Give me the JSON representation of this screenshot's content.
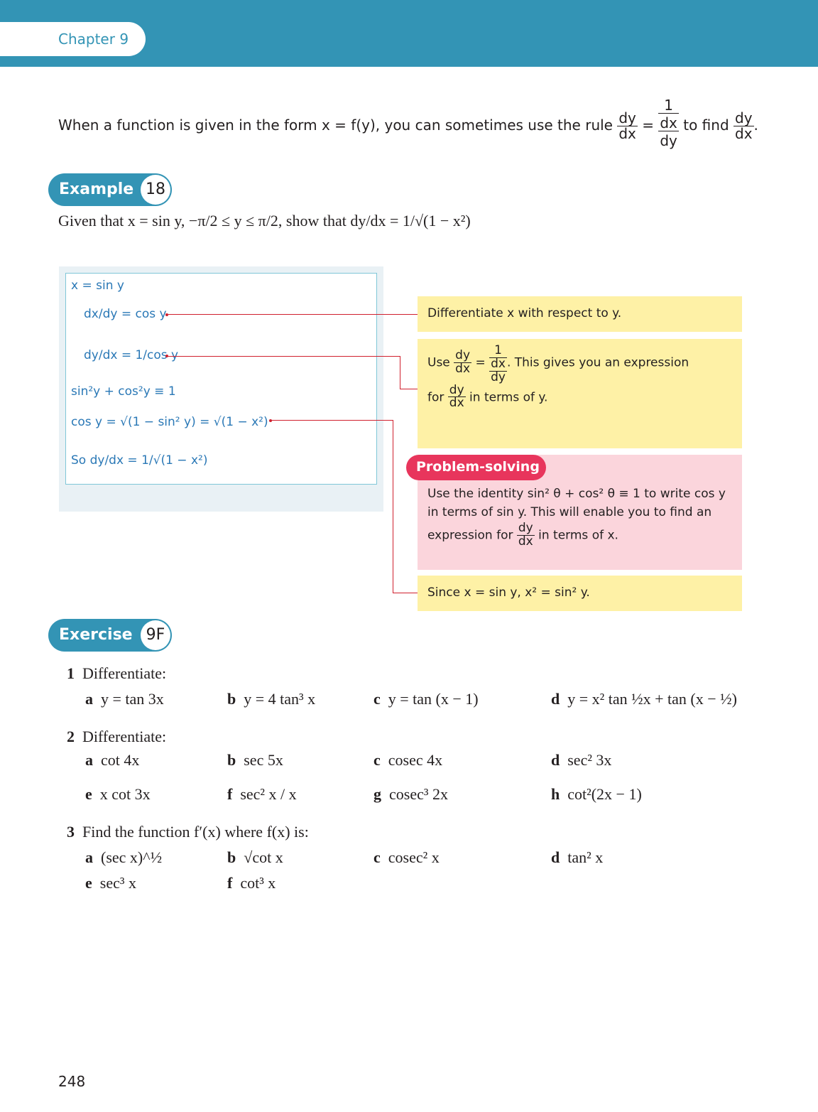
{
  "header": {
    "chapter_label": "Chapter 9"
  },
  "intro": {
    "text": "When a function is given in the form x = f(y), you can sometimes use the rule",
    "rule_lhs_num": "dy",
    "rule_lhs_den": "dx",
    "rule_eq": "=",
    "rule_rhs_num": "1",
    "rule_rhs_den_num": "dx",
    "rule_rhs_den_den": "dy",
    "to_find": "to find",
    "find_num": "dy",
    "find_den": "dx",
    "end": "."
  },
  "example": {
    "label": "Example",
    "number": "18",
    "given_text": "Given that x = sin y, −π/2 ≤ y ≤ π/2, show that dy/dx = 1/√(1 − x²)"
  },
  "working": [
    "x = sin y",
    "dx/dy = cos y",
    "dy/dx = 1/cos y",
    "sin²y + cos²y ≡ 1",
    "cos y = √(1 − sin² y) = √(1 − x²)",
    "So dy/dx = 1/√(1 − x²)"
  ],
  "notes": {
    "n1": "Differentiate x with respect to y.",
    "n2_use": "Use",
    "n2_gives": ". This gives you an expression",
    "n2_for": "for",
    "n2_tail": "in terms of y.",
    "problem_solving_tag": "Problem-solving",
    "ps_line1": "Use the identity sin² θ + cos² θ ≡ 1 to write cos y",
    "ps_line2": "in terms of sin y. This will enable you to find an",
    "ps_line3a": "expression for",
    "ps_line3b": "in terms of x.",
    "n4": "Since x = sin y, x² = sin² y."
  },
  "exercise": {
    "label": "Exercise",
    "code": "9F",
    "questions": [
      {
        "num": "1",
        "prompt": "Differentiate:",
        "parts": [
          {
            "letter": "a",
            "text": "y = tan 3x"
          },
          {
            "letter": "b",
            "text": "y = 4 tan³ x"
          },
          {
            "letter": "c",
            "text": "y = tan (x − 1)"
          },
          {
            "letter": "d",
            "text": "y = x² tan ½x + tan (x − ½)"
          }
        ]
      },
      {
        "num": "2",
        "prompt": "Differentiate:",
        "parts": [
          {
            "letter": "a",
            "text": "cot 4x"
          },
          {
            "letter": "b",
            "text": "sec 5x"
          },
          {
            "letter": "c",
            "text": "cosec 4x"
          },
          {
            "letter": "d",
            "text": "sec² 3x"
          },
          {
            "letter": "e",
            "text": "x cot 3x"
          },
          {
            "letter": "f",
            "text": "sec² x / x"
          },
          {
            "letter": "g",
            "text": "cosec³ 2x"
          },
          {
            "letter": "h",
            "text": "cot²(2x − 1)"
          }
        ]
      },
      {
        "num": "3",
        "prompt": "Find the function f′(x) where f(x) is:",
        "parts": [
          {
            "letter": "a",
            "text": "(sec x)^½"
          },
          {
            "letter": "b",
            "text": "√cot x"
          },
          {
            "letter": "c",
            "text": "cosec² x"
          },
          {
            "letter": "d",
            "text": "tan² x"
          },
          {
            "letter": "e",
            "text": "sec³ x"
          },
          {
            "letter": "f",
            "text": "cot³ x"
          }
        ]
      }
    ]
  },
  "page_number": "248"
}
